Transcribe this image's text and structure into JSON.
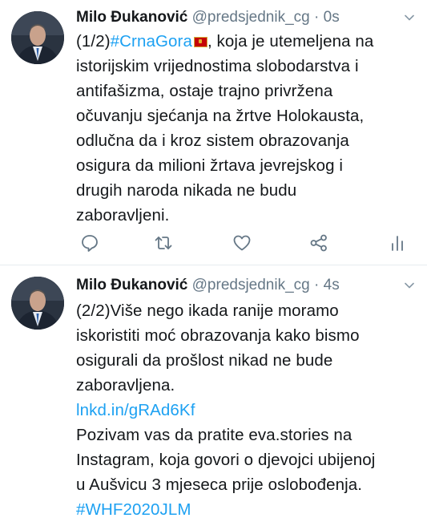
{
  "tweets": [
    {
      "author_name": "Milo Đukanović",
      "handle": "@predsjednik_cg",
      "separator": "·",
      "time": "0s",
      "text_lines": [
        {
          "before": "(1/2)",
          "link": "#CrnaGora",
          "flag": "flag-montenegro",
          "after": ", koja je utemeljena na"
        },
        {
          "text": "istorijskim vrijednostima slobodarstva i"
        },
        {
          "text": "antifašizma, ostaje trajno privržena"
        },
        {
          "text": "očuvanju sjećanja na žrtve Holokausta,"
        },
        {
          "text": "odlučna da i kroz sistem obrazovanja"
        },
        {
          "text": "osigura da milioni žrtava jevrejskog i"
        },
        {
          "text": "drugih naroda nikada ne budu"
        },
        {
          "text": "zaboravljeni."
        }
      ],
      "actions": [
        "reply-icon",
        "retweet-icon",
        "like-icon",
        "share-icon",
        "analytics-icon"
      ]
    },
    {
      "author_name": "Milo Đukanović",
      "handle": "@predsjednik_cg",
      "separator": "·",
      "time": "4s",
      "text_lines": [
        {
          "text": "(2/2)Više nego ikada ranije moramo"
        },
        {
          "text": "iskoristiti moć obrazovanja kako bismo"
        },
        {
          "text": "osigurali da prošlost nikad ne bude"
        },
        {
          "text": "zaboravljena."
        },
        {
          "link": "lnkd.in/gRAd6Kf"
        },
        {
          "text": "Pozivam vas da pratite eva.stories na"
        },
        {
          "text": "Instagram, koja govori o djevojci ubijenoj"
        },
        {
          "text": "u Aušvicu 3 mjeseca prije oslobođenja."
        },
        {
          "link": "#WHF2020JLM"
        }
      ]
    }
  ],
  "colors": {
    "link": "#1da1f2",
    "muted": "#657786",
    "text": "#14171a",
    "divider": "#e6ecf0"
  }
}
